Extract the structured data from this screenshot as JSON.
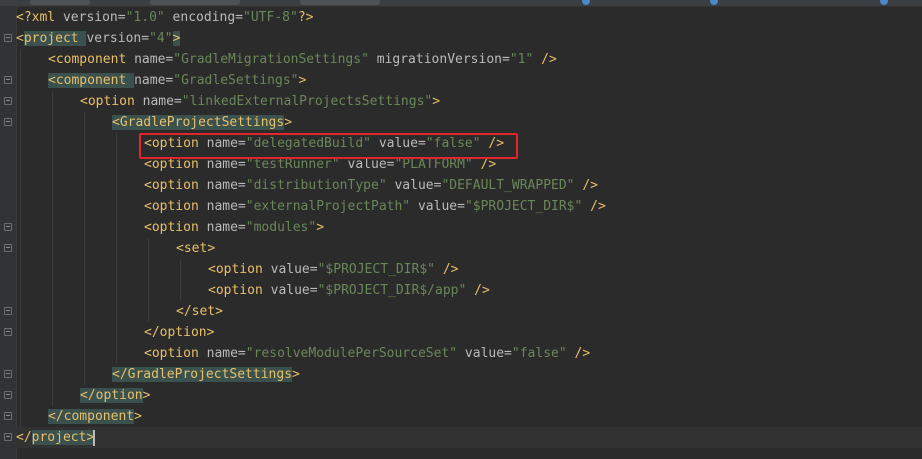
{
  "editor": {
    "lines": [
      {
        "indent": 0,
        "tokens": [
          [
            "punct",
            "<?"
          ],
          [
            "tag",
            "xml "
          ],
          [
            "attr",
            "version="
          ],
          [
            "val",
            "\"1.0\""
          ],
          [
            "attr",
            " encoding="
          ],
          [
            "val",
            "\"UTF-8\""
          ],
          [
            "punct",
            "?>"
          ]
        ]
      },
      {
        "indent": 0,
        "tokens": [
          [
            "punct",
            "<"
          ],
          [
            "tag",
            "project "
          ],
          [
            "attr",
            "version="
          ],
          [
            "val",
            "\"4\""
          ],
          [
            "punct",
            ">"
          ]
        ]
      },
      {
        "indent": 1,
        "tokens": [
          [
            "punct",
            "<"
          ],
          [
            "tag",
            "component "
          ],
          [
            "attr",
            "name="
          ],
          [
            "val",
            "\"GradleMigrationSettings\""
          ],
          [
            "attr",
            " migrationVersion="
          ],
          [
            "val",
            "\"1\""
          ],
          [
            "punct",
            " />"
          ]
        ]
      },
      {
        "indent": 1,
        "tokens": [
          [
            "punct",
            "<"
          ],
          [
            "tag",
            "component "
          ],
          [
            "attr",
            "name="
          ],
          [
            "val",
            "\"GradleSettings\""
          ],
          [
            "punct",
            ">"
          ]
        ]
      },
      {
        "indent": 2,
        "tokens": [
          [
            "punct",
            "<"
          ],
          [
            "tag",
            "option "
          ],
          [
            "attr",
            "name="
          ],
          [
            "val",
            "\"linkedExternalProjectsSettings\""
          ],
          [
            "punct",
            ">"
          ]
        ]
      },
      {
        "indent": 3,
        "tokens": [
          [
            "punct",
            "<"
          ],
          [
            "tag",
            "GradleProjectSettings"
          ],
          [
            "punct",
            ">"
          ]
        ]
      },
      {
        "indent": 4,
        "tokens": [
          [
            "punct",
            "<"
          ],
          [
            "tag",
            "option "
          ],
          [
            "attr",
            "name="
          ],
          [
            "val",
            "\"delegatedBuild\""
          ],
          [
            "attr",
            " value="
          ],
          [
            "val",
            "\"false\""
          ],
          [
            "punct",
            " />"
          ]
        ]
      },
      {
        "indent": 4,
        "tokens": [
          [
            "punct",
            "<"
          ],
          [
            "tag",
            "option "
          ],
          [
            "attr",
            "name="
          ],
          [
            "val",
            "\"testRunner\""
          ],
          [
            "attr",
            " value="
          ],
          [
            "val",
            "\"PLATFORM\""
          ],
          [
            "punct",
            " />"
          ]
        ]
      },
      {
        "indent": 4,
        "tokens": [
          [
            "punct",
            "<"
          ],
          [
            "tag",
            "option "
          ],
          [
            "attr",
            "name="
          ],
          [
            "val",
            "\"distributionType\""
          ],
          [
            "attr",
            " value="
          ],
          [
            "val",
            "\"DEFAULT_WRAPPED\""
          ],
          [
            "punct",
            " />"
          ]
        ]
      },
      {
        "indent": 4,
        "tokens": [
          [
            "punct",
            "<"
          ],
          [
            "tag",
            "option "
          ],
          [
            "attr",
            "name="
          ],
          [
            "val",
            "\"externalProjectPath\""
          ],
          [
            "attr",
            " value="
          ],
          [
            "val",
            "\"$PROJECT_DIR$\""
          ],
          [
            "punct",
            " />"
          ]
        ]
      },
      {
        "indent": 4,
        "tokens": [
          [
            "punct",
            "<"
          ],
          [
            "tag",
            "option "
          ],
          [
            "attr",
            "name="
          ],
          [
            "val",
            "\"modules\""
          ],
          [
            "punct",
            ">"
          ]
        ]
      },
      {
        "indent": 5,
        "tokens": [
          [
            "punct",
            "<"
          ],
          [
            "tag",
            "set"
          ],
          [
            "punct",
            ">"
          ]
        ]
      },
      {
        "indent": 6,
        "tokens": [
          [
            "punct",
            "<"
          ],
          [
            "tag",
            "option "
          ],
          [
            "attr",
            "value="
          ],
          [
            "val",
            "\"$PROJECT_DIR$\""
          ],
          [
            "punct",
            " />"
          ]
        ]
      },
      {
        "indent": 6,
        "tokens": [
          [
            "punct",
            "<"
          ],
          [
            "tag",
            "option "
          ],
          [
            "attr",
            "value="
          ],
          [
            "val",
            "\"$PROJECT_DIR$/app\""
          ],
          [
            "punct",
            " />"
          ]
        ]
      },
      {
        "indent": 5,
        "tokens": [
          [
            "punct",
            "</"
          ],
          [
            "tag",
            "set"
          ],
          [
            "punct",
            ">"
          ]
        ]
      },
      {
        "indent": 4,
        "tokens": [
          [
            "punct",
            "</"
          ],
          [
            "tag",
            "option"
          ],
          [
            "punct",
            ">"
          ]
        ]
      },
      {
        "indent": 4,
        "tokens": [
          [
            "punct",
            "<"
          ],
          [
            "tag",
            "option "
          ],
          [
            "attr",
            "name="
          ],
          [
            "val",
            "\"resolveModulePerSourceSet\""
          ],
          [
            "attr",
            " value="
          ],
          [
            "val",
            "\"false\""
          ],
          [
            "punct",
            " />"
          ]
        ]
      },
      {
        "indent": 3,
        "tokens": [
          [
            "punct",
            "</"
          ],
          [
            "tag",
            "GradleProjectSettings"
          ],
          [
            "punct",
            ">"
          ]
        ]
      },
      {
        "indent": 2,
        "tokens": [
          [
            "punct",
            "</"
          ],
          [
            "tag",
            "option"
          ],
          [
            "punct",
            ">"
          ]
        ]
      },
      {
        "indent": 1,
        "tokens": [
          [
            "punct",
            "</"
          ],
          [
            "tag",
            "component"
          ],
          [
            "punct",
            ">"
          ]
        ]
      },
      {
        "indent": 0,
        "tokens": [
          [
            "punct",
            "</"
          ],
          [
            "tag",
            "project"
          ],
          [
            "punct",
            ">"
          ]
        ]
      }
    ],
    "highlighted_line": 6,
    "current_line": 20,
    "bracket_match_lines": [
      1,
      20
    ],
    "tag_highlight_lines": [
      3,
      5,
      17,
      18,
      19
    ],
    "colors": {
      "background": "#2b2b2b",
      "tag": "#e8bf6a",
      "attribute": "#bababa",
      "value": "#6a8759",
      "annotation_box": "#e0262a"
    }
  }
}
